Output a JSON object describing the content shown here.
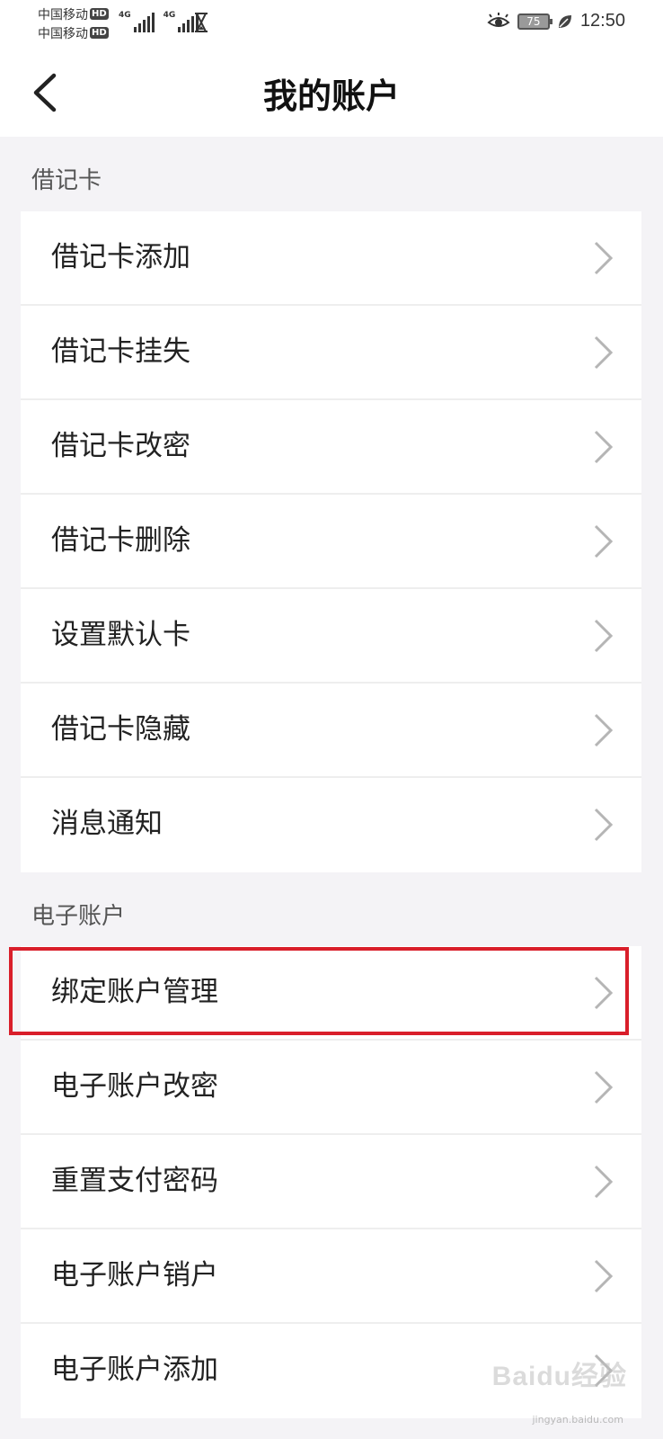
{
  "status_bar": {
    "carrier_1": "中国移动",
    "carrier_2": "中国移动",
    "hd_badge": "HD",
    "network_1": "4G",
    "network_2": "4G",
    "battery": "75",
    "time": "12:50"
  },
  "header": {
    "title": "我的账户",
    "back_icon": "chevron-left-icon"
  },
  "sections": {
    "debit": {
      "label": "借记卡",
      "items": [
        {
          "label": "借记卡添加"
        },
        {
          "label": "借记卡挂失"
        },
        {
          "label": "借记卡改密"
        },
        {
          "label": "借记卡删除"
        },
        {
          "label": "设置默认卡"
        },
        {
          "label": "借记卡隐藏"
        },
        {
          "label": "消息通知"
        }
      ]
    },
    "electronic": {
      "label": "电子账户",
      "items": [
        {
          "label": "绑定账户管理"
        },
        {
          "label": "电子账户改密"
        },
        {
          "label": "重置支付密码"
        },
        {
          "label": "电子账户销户"
        },
        {
          "label": "电子账户添加"
        }
      ]
    }
  },
  "annotation": {
    "highlight_color": "#d91e2a",
    "highlighted_item": "绑定账户管理"
  },
  "watermark": {
    "text": "Baidu经验",
    "sub": "jingyan.baidu.com"
  }
}
